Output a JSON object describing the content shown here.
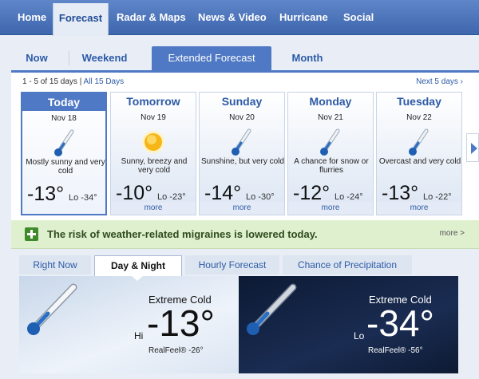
{
  "nav": {
    "items": [
      "Home",
      "Forecast",
      "Radar & Maps",
      "News & Video",
      "Hurricane",
      "Social"
    ],
    "active": "Forecast"
  },
  "subtabs": {
    "now": "Now",
    "weekend": "Weekend",
    "extended": "Extended Forecast",
    "month": "Month"
  },
  "range": {
    "text": "1 - 5 of 15 days |",
    "all": "All 15 Days",
    "next": "Next 5 days ›"
  },
  "days": [
    {
      "name": "Today",
      "date": "Nov 18",
      "icon": "thermometer-cold-icon",
      "desc": "Mostly sunny and very cold",
      "hi": "-13°",
      "lo": "Lo -34°",
      "more": ""
    },
    {
      "name": "Tomorrow",
      "date": "Nov 19",
      "icon": "sun-icon",
      "desc": "Sunny, breezy and very cold",
      "hi": "-10°",
      "lo": "Lo -23°",
      "more": "more"
    },
    {
      "name": "Sunday",
      "date": "Nov 20",
      "icon": "thermometer-cold-icon",
      "desc": "Sunshine, but very cold",
      "hi": "-14°",
      "lo": "Lo -30°",
      "more": "more"
    },
    {
      "name": "Monday",
      "date": "Nov 21",
      "icon": "thermometer-cold-icon",
      "desc": "A chance for snow or flurries",
      "hi": "-12°",
      "lo": "Lo -24°",
      "more": "more"
    },
    {
      "name": "Tuesday",
      "date": "Nov 22",
      "icon": "thermometer-cold-icon",
      "desc": "Overcast and very cold",
      "hi": "-13°",
      "lo": "Lo -22°",
      "more": "more"
    }
  ],
  "banner": {
    "message": "The risk of weather-related migraines is lowered today.",
    "more": "more >"
  },
  "lower_tabs": {
    "right_now": "Right Now",
    "day_night": "Day & Night",
    "hourly": "Hourly Forecast",
    "precip": "Chance of Precipitation"
  },
  "day_panel": {
    "condition": "Extreme Cold",
    "label": "Hi",
    "temp": "-13°",
    "realfeel": "RealFeel® -26°"
  },
  "night_panel": {
    "condition": "Extreme Cold",
    "label": "Lo",
    "temp": "-34°",
    "realfeel": "RealFeel® -56°"
  },
  "colors": {
    "accent": "#4f79c4",
    "nav": "#3e66ad",
    "banner": "#dff0cf",
    "night": "#1a2c52"
  }
}
